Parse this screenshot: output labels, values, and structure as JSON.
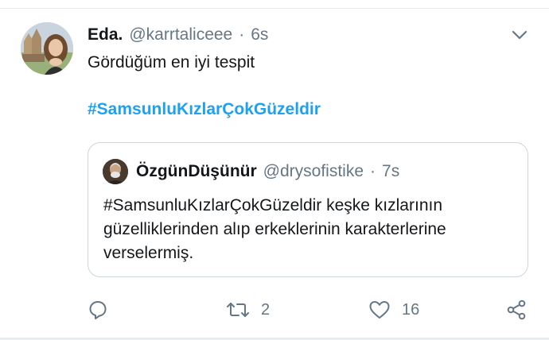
{
  "tweet": {
    "display_name": "Eda.",
    "handle": "@karrtaliceee",
    "separator": "·",
    "time": "6s",
    "text": "Gördüğüm en iyi tespit",
    "hashtag": "#SamsunluKızlarÇokGüzeldir"
  },
  "quoted": {
    "display_name": "ÖzgünDüşünür",
    "handle": "@drysofistike",
    "separator": "·",
    "time": "7s",
    "text": "#SamsunluKızlarÇokGüzeldir keşke kızlarının güzelliklerinden alıp erkeklerinin karakterlerine verselermiş."
  },
  "actions": {
    "reply_count": "",
    "retweet_count": "2",
    "like_count": "16"
  },
  "icons": {
    "caret": "chevron-down-icon",
    "reply": "reply-icon",
    "retweet": "retweet-icon",
    "like": "heart-icon",
    "share": "share-icon"
  },
  "colors": {
    "hashtag": "#1da1f2",
    "secondary_text": "#657786",
    "border": "#ccd6dd"
  }
}
